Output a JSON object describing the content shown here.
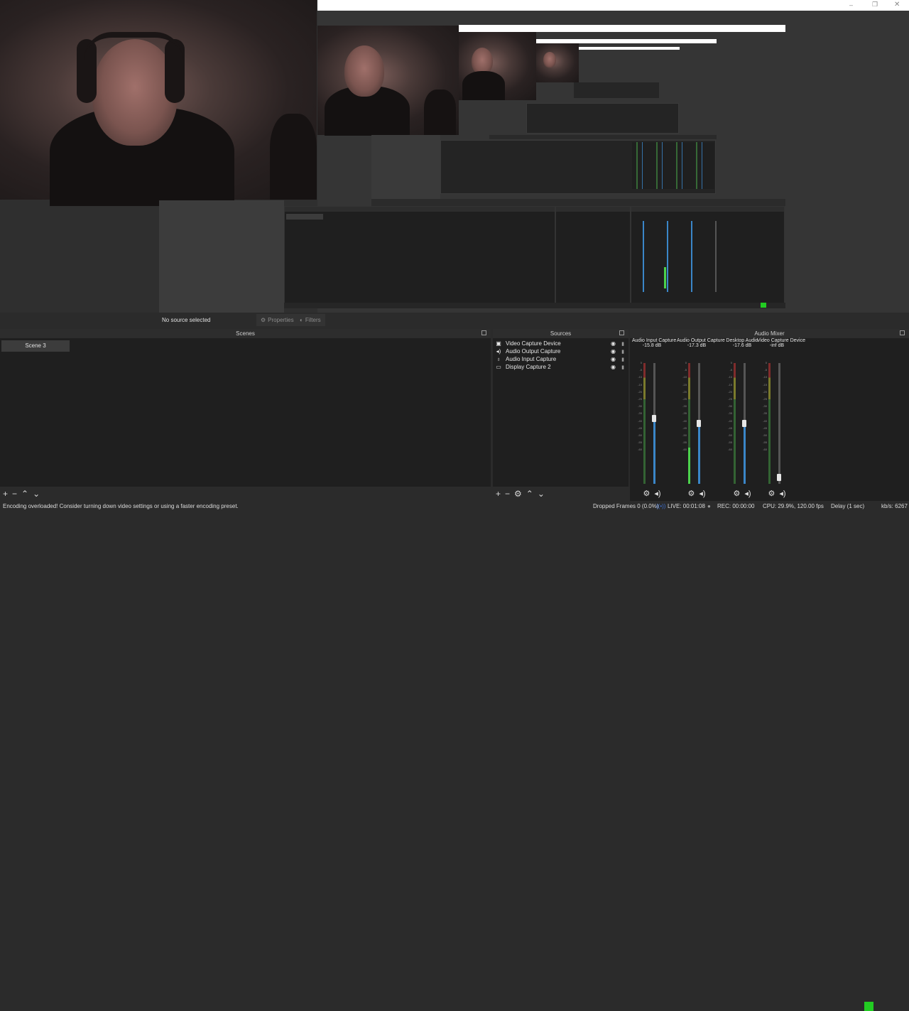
{
  "preview": {
    "no_source_label": "No source selected",
    "properties_label": "Properties",
    "filters_label": "Filters"
  },
  "scenes": {
    "title": "Scenes",
    "items": [
      "Scene 3"
    ]
  },
  "sources": {
    "title": "Sources",
    "items": [
      {
        "name": "Video Capture Device",
        "icon": "camera-icon"
      },
      {
        "name": "Audio Output Capture",
        "icon": "speaker-icon"
      },
      {
        "name": "Audio Input Capture",
        "icon": "microphone-icon"
      },
      {
        "name": "Display Capture 2",
        "icon": "monitor-icon"
      }
    ]
  },
  "mixer": {
    "title": "Audio Mixer",
    "channels": [
      {
        "name": "Audio Input Capture",
        "db": "-15.8 dB",
        "fader_level": 0.54,
        "meter_level": 0.0
      },
      {
        "name": "Audio Output Capture",
        "db": "-17.3 dB",
        "fader_level": 0.5,
        "meter_level": 0.3
      },
      {
        "name": "Desktop Audio",
        "db": "-17.6 dB",
        "fader_level": 0.5,
        "meter_level": 0.0
      },
      {
        "name": "Video Capture Device",
        "db": "-inf dB",
        "fader_level": 0.05,
        "meter_level": 0.0
      }
    ],
    "ticks": [
      "0",
      "-5",
      "-10",
      "-15",
      "-20",
      "-25",
      "-30",
      "-35",
      "-40",
      "-45",
      "-50",
      "-55",
      "-60"
    ]
  },
  "status": {
    "message": "Encoding overloaded! Consider turning down video settings or using a faster encoding preset.",
    "dropped": "Dropped Frames 0 (0.0%)",
    "live": "LIVE: 00:01:08",
    "rec": "REC: 00:00:00",
    "cpu": "CPU: 29.9%, 120.00 fps",
    "delay": "Delay (1 sec)",
    "kbps": "kb/s: 6267"
  },
  "colors": {
    "accent_green": "#22cc22",
    "fader_blue": "#3a86c8"
  }
}
